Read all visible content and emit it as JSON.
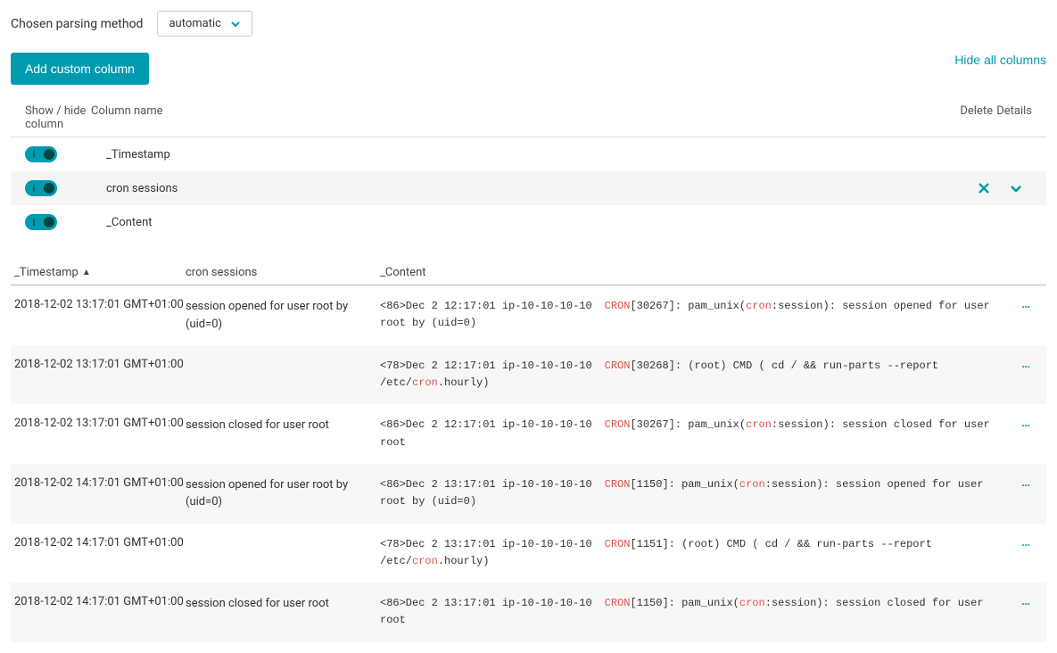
{
  "parsing": {
    "label": "Chosen parsing method",
    "value": "automatic"
  },
  "buttons": {
    "add_column": "Add custom column",
    "hide_all": "Hide all columns"
  },
  "columns_header": {
    "show_hide": "Show / hide column",
    "name": "Column name",
    "delete": "Delete",
    "details": "Details"
  },
  "columns": [
    {
      "name": "_Timestamp",
      "on": true,
      "active": false,
      "deletable": false
    },
    {
      "name": "cron sessions",
      "on": true,
      "active": true,
      "deletable": true
    },
    {
      "name": "_Content",
      "on": true,
      "active": false,
      "deletable": false
    }
  ],
  "table_headers": {
    "timestamp": "_Timestamp",
    "cron": "cron sessions",
    "content": "_Content"
  },
  "rows": [
    {
      "timestamp": "2018-12-02 13:17:01 GMT+01:00",
      "cron": "session opened for user root by (uid=0)",
      "content": [
        {
          "t": "<86>Dec  2 12:17:01 ip-10-10-10-10"
        },
        {
          "sp": true
        },
        {
          "t": "CRON",
          "c": "hl-cron"
        },
        {
          "t": "[30267]:  pam_unix("
        },
        {
          "t": "cron",
          "c": "hl-kw"
        },
        {
          "t": ":session): session opened for user root by (uid=0)"
        }
      ]
    },
    {
      "timestamp": "2018-12-02 13:17:01 GMT+01:00",
      "cron": "",
      "content": [
        {
          "t": "<78>Dec  2 12:17:01 ip-10-10-10-10"
        },
        {
          "sp": true
        },
        {
          "t": "CRON",
          "c": "hl-cron"
        },
        {
          "t": "[30268]:  (root) CMD (   cd / && run-parts --report /etc/"
        },
        {
          "t": "cron",
          "c": "hl-kw"
        },
        {
          "t": ".hourly)"
        }
      ]
    },
    {
      "timestamp": "2018-12-02 13:17:01 GMT+01:00",
      "cron": "session closed for user root",
      "content": [
        {
          "t": "<86>Dec  2 12:17:01 ip-10-10-10-10"
        },
        {
          "sp": true
        },
        {
          "t": "CRON",
          "c": "hl-cron"
        },
        {
          "t": "[30267]:  pam_unix("
        },
        {
          "t": "cron",
          "c": "hl-kw"
        },
        {
          "t": ":session): session closed for user root"
        }
      ]
    },
    {
      "timestamp": "2018-12-02 14:17:01 GMT+01:00",
      "cron": "session opened for user root by (uid=0)",
      "content": [
        {
          "t": "<86>Dec  2 13:17:01 ip-10-10-10-10"
        },
        {
          "sp": true
        },
        {
          "t": "CRON",
          "c": "hl-cron"
        },
        {
          "t": "[1150]:  pam_unix("
        },
        {
          "t": "cron",
          "c": "hl-kw"
        },
        {
          "t": ":session): session opened for user root by (uid=0)"
        }
      ]
    },
    {
      "timestamp": "2018-12-02 14:17:01 GMT+01:00",
      "cron": "",
      "content": [
        {
          "t": "<78>Dec  2 13:17:01 ip-10-10-10-10"
        },
        {
          "sp": true
        },
        {
          "t": "CRON",
          "c": "hl-cron"
        },
        {
          "t": "[1151]:  (root) CMD (   cd / && run-parts --report /etc/"
        },
        {
          "t": "cron",
          "c": "hl-kw"
        },
        {
          "t": ".hourly)"
        }
      ]
    },
    {
      "timestamp": "2018-12-02 14:17:01 GMT+01:00",
      "cron": "session closed for user root",
      "content": [
        {
          "t": "<86>Dec  2 13:17:01 ip-10-10-10-10"
        },
        {
          "sp": true
        },
        {
          "t": "CRON",
          "c": "hl-cron"
        },
        {
          "t": "[1150]:  pam_unix("
        },
        {
          "t": "cron",
          "c": "hl-kw"
        },
        {
          "t": ":session): session closed for user root"
        }
      ]
    }
  ]
}
